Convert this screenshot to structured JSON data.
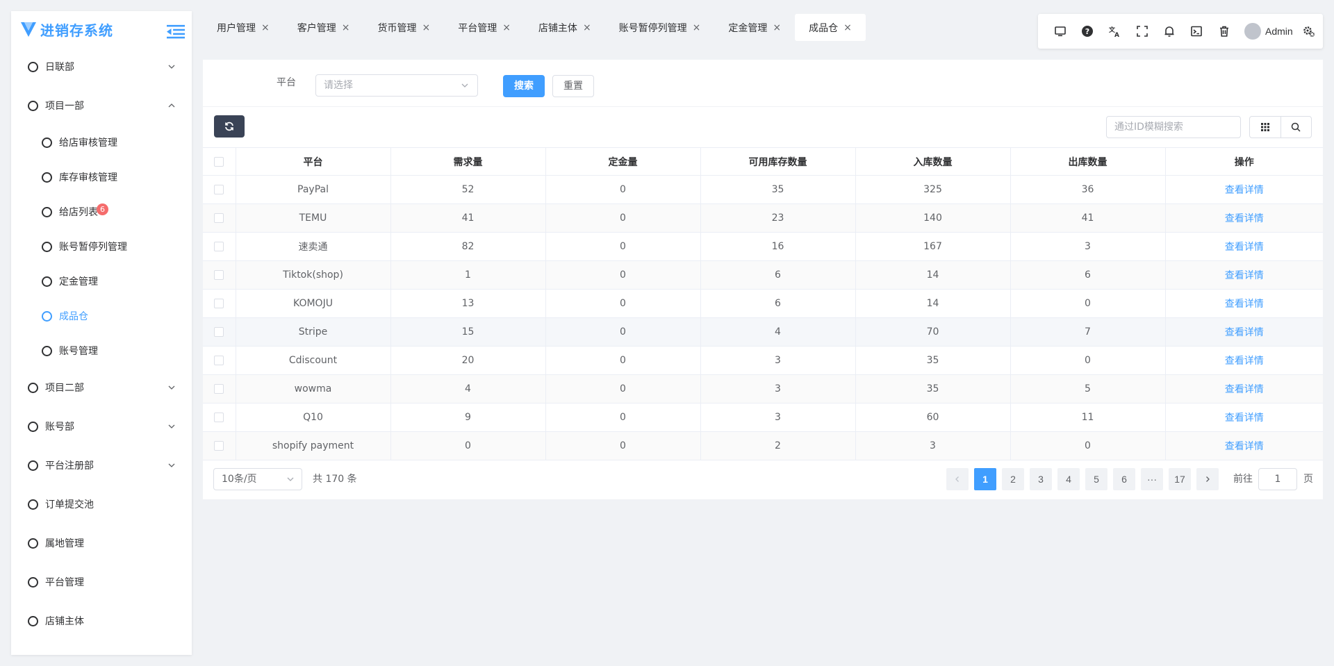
{
  "app": {
    "title": "进销存系统",
    "accent": "#409eff"
  },
  "sidebar": {
    "groups": [
      {
        "label": "日联部",
        "expanded": false
      },
      {
        "label": "项目一部",
        "expanded": true,
        "children": [
          {
            "label": "给店审核管理",
            "active": false
          },
          {
            "label": "库存审核管理",
            "active": false
          },
          {
            "label": "给店列表",
            "badge": "6",
            "active": false
          },
          {
            "label": "账号暂停列管理",
            "active": false
          },
          {
            "label": "定金管理",
            "active": false
          },
          {
            "label": "成品仓",
            "active": true
          },
          {
            "label": "账号管理",
            "active": false
          }
        ]
      },
      {
        "label": "项目二部",
        "expanded": false
      },
      {
        "label": "账号部",
        "expanded": false
      },
      {
        "label": "平台注册部",
        "expanded": false
      },
      {
        "label": "订单提交池"
      },
      {
        "label": "属地管理"
      },
      {
        "label": "平台管理"
      },
      {
        "label": "店铺主体"
      }
    ]
  },
  "tabs": [
    {
      "label": "用户管理",
      "close": "×"
    },
    {
      "label": "客户管理",
      "close": "×"
    },
    {
      "label": "货币管理",
      "close": "×"
    },
    {
      "label": "平台管理",
      "close": "×"
    },
    {
      "label": "店铺主体",
      "close": "×"
    },
    {
      "label": "账号暂停列管理",
      "close": "×"
    },
    {
      "label": "定金管理",
      "close": "×"
    },
    {
      "label": "成品仓",
      "close": "×",
      "active": true
    }
  ],
  "topbar": {
    "icons": [
      "monitor-icon",
      "help-icon",
      "translate-icon",
      "fullscreen-icon",
      "bell-icon",
      "terminal-icon",
      "trash-icon"
    ],
    "user": "Admin",
    "settings_icon": "gear-icon"
  },
  "search": {
    "platform_label": "平台",
    "platform_placeholder": "请选择",
    "search_button": "搜索",
    "reset_button": "重置"
  },
  "table_toolbar": {
    "id_search_placeholder": "通过ID模糊搜索"
  },
  "table": {
    "columns": [
      "平台",
      "需求量",
      "定金量",
      "可用库存数量",
      "入库数量",
      "出库数量",
      "操作"
    ],
    "rows": [
      [
        "PayPal",
        "52",
        "0",
        "35",
        "325",
        "36",
        "查看详情"
      ],
      [
        "TEMU",
        "41",
        "0",
        "23",
        "140",
        "41",
        "查看详情"
      ],
      [
        "速卖通",
        "82",
        "0",
        "16",
        "167",
        "3",
        "查看详情"
      ],
      [
        "Tiktok(shop)",
        "1",
        "0",
        "6",
        "14",
        "6",
        "查看详情"
      ],
      [
        "KOMOJU",
        "13",
        "0",
        "6",
        "14",
        "0",
        "查看详情"
      ],
      [
        "Stripe",
        "15",
        "0",
        "4",
        "70",
        "7",
        "查看详情"
      ],
      [
        "Cdiscount",
        "20",
        "0",
        "3",
        "35",
        "0",
        "查看详情"
      ],
      [
        "wowma",
        "4",
        "0",
        "3",
        "35",
        "5",
        "查看详情"
      ],
      [
        "Q10",
        "9",
        "0",
        "3",
        "60",
        "11",
        "查看详情"
      ],
      [
        "shopify payment",
        "0",
        "0",
        "2",
        "3",
        "0",
        "查看详情"
      ]
    ]
  },
  "pagination": {
    "page_size": "10条/页",
    "total": "共 170 条",
    "pages": [
      "1",
      "2",
      "3",
      "4",
      "5",
      "6",
      "···",
      "17"
    ],
    "current": "1",
    "goto_label": "前往",
    "goto_value": "1",
    "goto_suffix": "页"
  }
}
